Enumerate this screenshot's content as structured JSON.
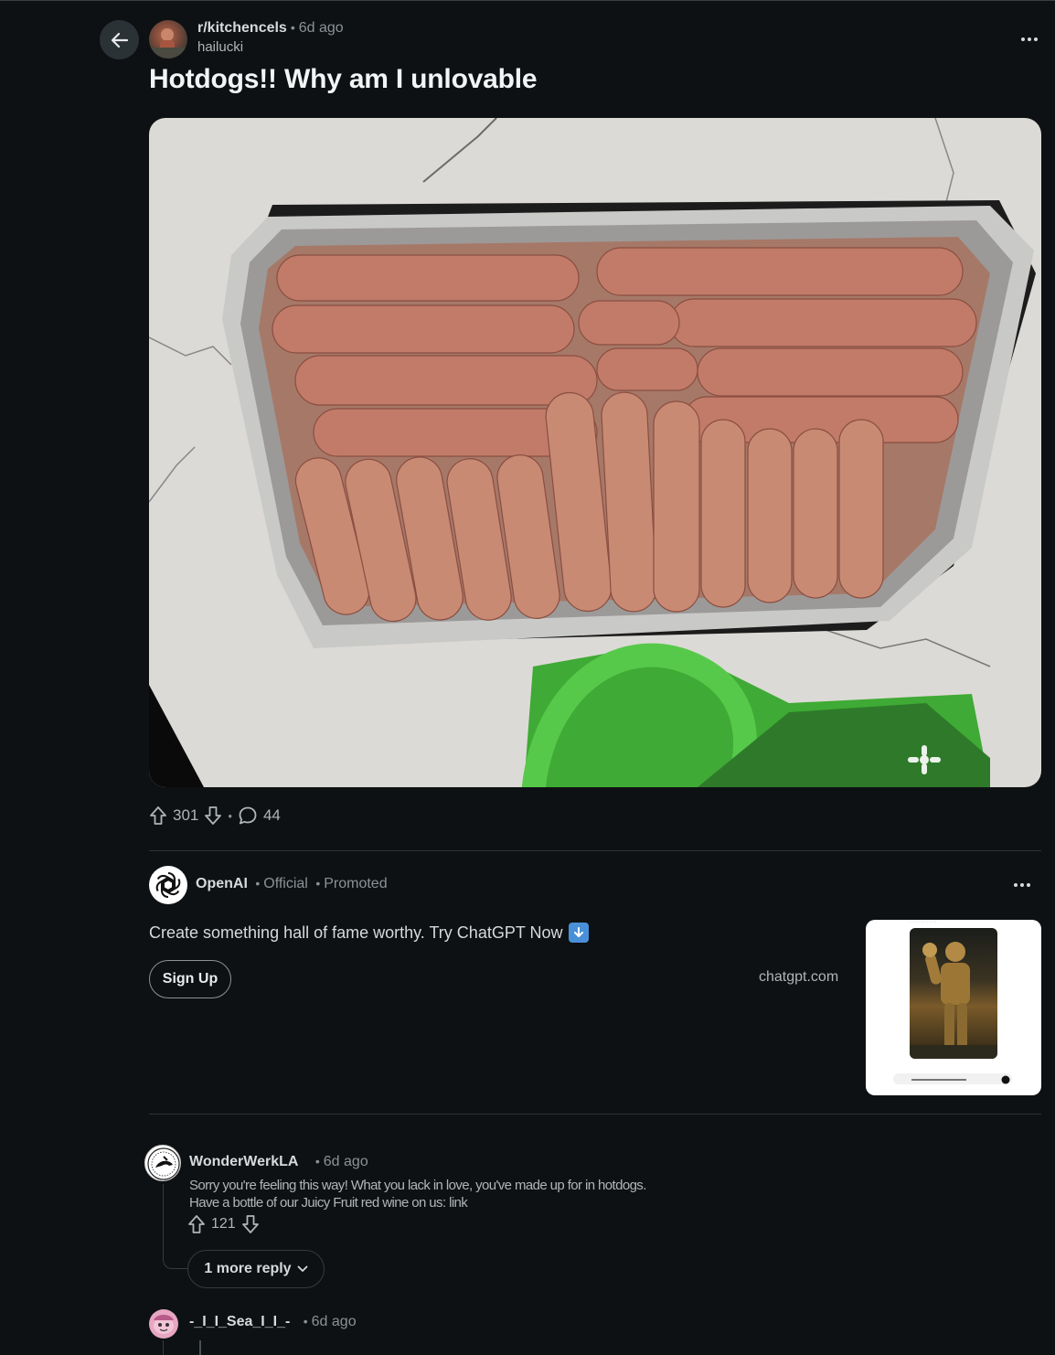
{
  "post": {
    "subreddit": "r/kitchencels",
    "time": "6d ago",
    "author": "hailucki",
    "title": "Hotdogs!! Why am I unlovable",
    "upvotes": "301",
    "comments": "44"
  },
  "ad": {
    "advertiser": "OpenAI",
    "official": "Official",
    "promoted": "Promoted",
    "text": "Create something hall of fame worthy. Try ChatGPT Now",
    "cta": "Sign Up",
    "domain": "chatgpt.com"
  },
  "comments": [
    {
      "user": "WonderWerkLA",
      "time": "6d ago",
      "body_line1": "Sorry you're feeling this way! What you lack in love, you've made up for in hotdogs.",
      "body_line2": "Have a bottle of our Juicy Fruit red wine on us: link",
      "votes": "121",
      "more_replies": "1 more reply"
    },
    {
      "user": "-_I_I_Sea_I_I_-",
      "time": "6d ago"
    }
  ],
  "colors": {
    "background": "#0e1113",
    "text": "#d7dadc",
    "muted": "#8b9295"
  }
}
